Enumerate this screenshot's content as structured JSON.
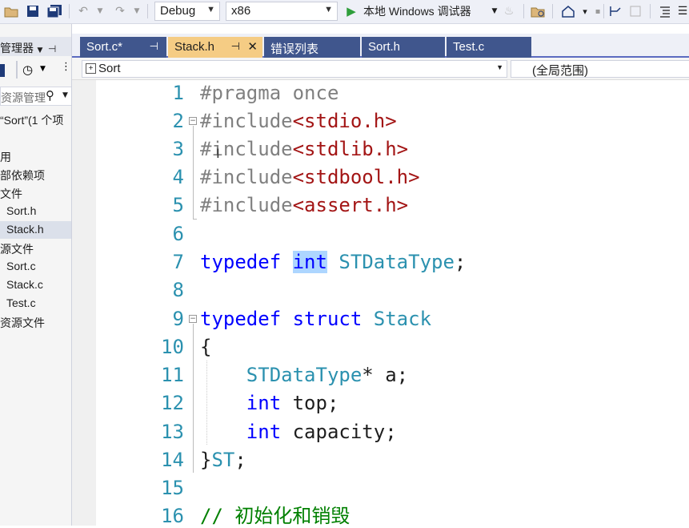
{
  "toolbar": {
    "config": "Debug",
    "platform": "x86",
    "run_label": "本地 Windows 调试器",
    "icon_names": [
      "open-folder-icon",
      "save-icon",
      "save-all-icon",
      "undo-icon",
      "redo-icon",
      "play-icon",
      "hot-reload-icon",
      "folder-icon",
      "home-icon",
      "bookmark-icon",
      "format-icon"
    ]
  },
  "sidebar": {
    "title": "管理器",
    "search_placeholder": "资源管理",
    "solution_label": "“Sort”(1 个项",
    "items": [
      {
        "label": "用",
        "selected": false
      },
      {
        "label": "部依赖项",
        "selected": false
      },
      {
        "label": "文件",
        "selected": false
      },
      {
        "label": "Sort.h",
        "selected": false
      },
      {
        "label": "Stack.h",
        "selected": true
      },
      {
        "label": "源文件",
        "selected": false
      },
      {
        "label": "Sort.c",
        "selected": false
      },
      {
        "label": "Stack.c",
        "selected": false
      },
      {
        "label": "Test.c",
        "selected": false
      },
      {
        "label": "资源文件",
        "selected": false
      }
    ]
  },
  "tabs": [
    {
      "label": "Sort.c*",
      "active": false
    },
    {
      "label": "Stack.h",
      "active": true
    },
    {
      "label": "错误列表",
      "active": false
    },
    {
      "label": "Sort.h",
      "active": false
    },
    {
      "label": "Test.c",
      "active": false
    }
  ],
  "navbar": {
    "project": "Sort",
    "scope": "(全局范围)"
  },
  "editor": {
    "line_numbers": [
      "1",
      "2",
      "3",
      "4",
      "5",
      "6",
      "7",
      "8",
      "9",
      "10",
      "11",
      "12",
      "13",
      "14",
      "15",
      "16"
    ],
    "lines": {
      "l1": "#pragma once",
      "l2a": "#include",
      "l2b": "<stdio.h>",
      "l3a": "#include",
      "l3b": "<stdlib.h>",
      "l4a": "#include",
      "l4b": "<stdbool.h>",
      "l5a": "#include",
      "l5b": "<assert.h>",
      "l7a": "typedef",
      "l7b": "int",
      "l7c": "STDataType",
      "l7d": ";",
      "l9a": "typedef",
      "l9b": "struct",
      "l9c": "Stack",
      "l10": "{",
      "l11a": "STDataType",
      "l11b": "* a;",
      "l12a": "int",
      "l12b": " top;",
      "l13a": "int",
      "l13b": " capacity;",
      "l14a": "}",
      "l14b": "ST",
      "l14c": ";",
      "l16": "// 初始化和销毁"
    }
  }
}
